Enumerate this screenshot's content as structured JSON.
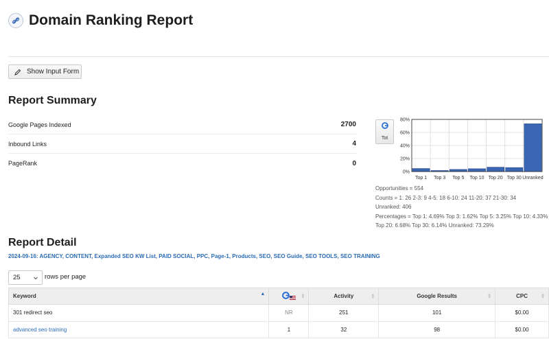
{
  "header": {
    "title": "Domain Ranking Report",
    "logo_icon": "link-icon"
  },
  "toolbar": {
    "show_input_label": "Show Input Form"
  },
  "summary": {
    "title": "Report Summary",
    "rows": [
      {
        "label": "Google Pages Indexed",
        "value": "2700"
      },
      {
        "label": "Inbound Links",
        "value": "4"
      },
      {
        "label": "PageRank",
        "value": "0"
      }
    ]
  },
  "chart_toggle": {
    "label": "Tot",
    "icon": "google-icon"
  },
  "chart_data": {
    "type": "bar",
    "categories": [
      "Top 1",
      "Top 3",
      "Top 5",
      "Top 10",
      "Top 20",
      "Top 30",
      "Unranked"
    ],
    "values": [
      4.69,
      1.62,
      3.25,
      4.33,
      6.68,
      6.14,
      73.29
    ],
    "ylim": [
      0,
      80
    ],
    "yticks": [
      "0%",
      "20%",
      "40%",
      "60%",
      "80%"
    ],
    "bar_color": "#3b66b4",
    "grid": true
  },
  "chart_notes": {
    "opportunities": "Opportunities = 554",
    "counts": "Counts = 1: 26 2-3: 9 4-5: 18 6-10: 24 11-20: 37 21-30: 34",
    "unranked": "Unranked: 406",
    "percentages": "Percentages = Top 1: 4.69% Top 3: 1.62% Top 5: 3.25% Top 10: 4.33% Top 20: 6.68% Top 30: 6.14% Unranked: 73.29%"
  },
  "detail": {
    "title": "Report Detail",
    "tags": "2024-09-16: AGENCY, CONTENT, Expanded SEO KW List, PAID SOCIAL, PPC, Page-1, Products, SEO, SEO Guide, SEO TOOLS, SEO TRAINING",
    "rows_per_page": {
      "value": "25",
      "label": "rows per page"
    }
  },
  "table": {
    "headers": {
      "keyword": "Keyword",
      "activity": "Activity",
      "google_results": "Google Results",
      "cpc": "CPC"
    },
    "rank_header_icons": [
      "google-icon",
      "us-flag-icon"
    ],
    "rows": [
      {
        "keyword": "301 redirect seo",
        "rank": "NR",
        "activity": "251",
        "google_results": "101",
        "cpc": "$0.00"
      },
      {
        "keyword": "advanced seo training",
        "rank": "1",
        "activity": "32",
        "google_results": "98",
        "cpc": "$0.00"
      }
    ]
  }
}
